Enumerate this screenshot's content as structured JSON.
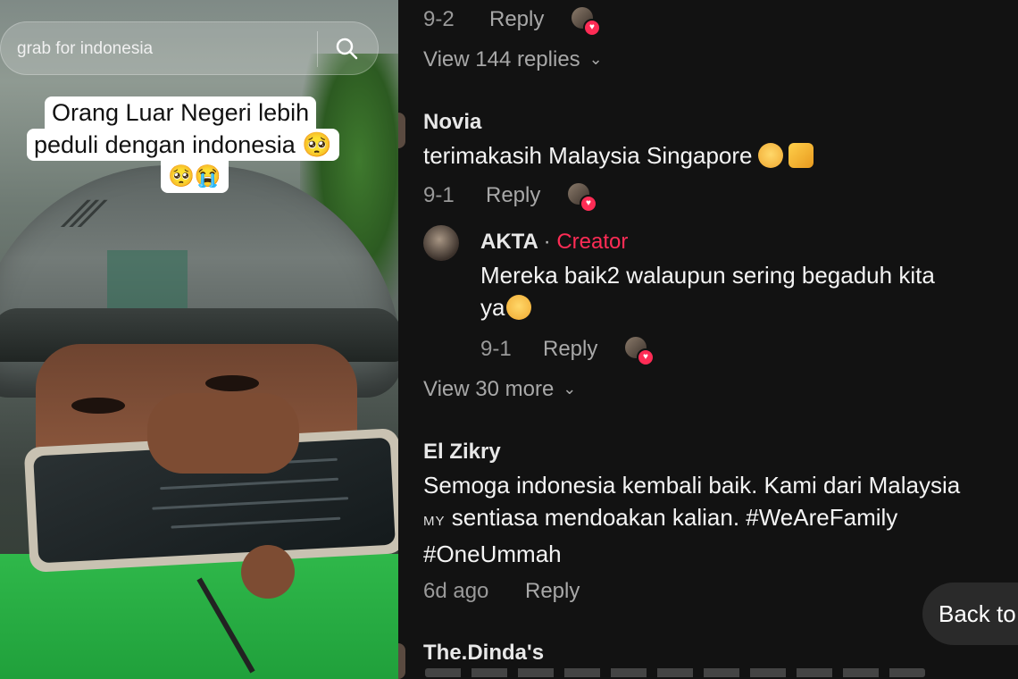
{
  "video": {
    "search": {
      "query": "grab for indonesia"
    },
    "caption": {
      "line1": "Orang Luar Negeri lebih",
      "line2": "peduli dengan indonesia 🥺",
      "line3": "🥺😭"
    }
  },
  "comments": {
    "top": {
      "date": "9-2",
      "reply": "Reply"
    },
    "view_replies_1": "View 144 replies",
    "items": [
      {
        "username": "Novia",
        "text": "terimakasih Malaysia Singapore",
        "date": "9-1",
        "reply": "Reply"
      },
      {
        "username": "AKTA",
        "badge": "Creator",
        "separator": "·",
        "text_line1": "Mereka baik2 walaupun sering begaduh kita",
        "text_line2": "ya",
        "date": "9-1",
        "reply": "Reply"
      },
      {
        "username": "El Zikry",
        "text_line1": "Semoga indonesia kembali baik. Kami dari Malaysia",
        "flag": "MY",
        "text_line2": "sentiasa mendoakan kalian. #WeAreFamily",
        "text_line3": "#OneUmmah",
        "date": "6d ago",
        "reply": "Reply"
      },
      {
        "username": "The.Dinda's"
      }
    ],
    "view_more": "View 30 more",
    "back_button": "Back to"
  },
  "colors": {
    "accent": "#fe2c55",
    "background": "#121212",
    "caption_bg": "#ffffff",
    "jacket": "#2fb84a"
  }
}
